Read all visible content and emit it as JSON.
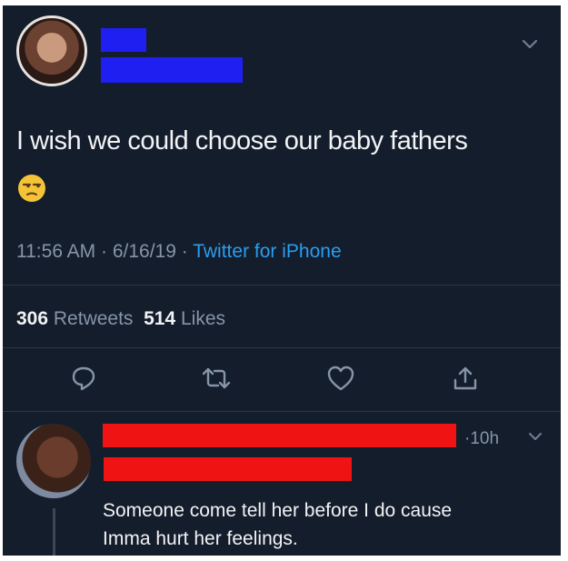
{
  "tweet": {
    "text": "I wish we could choose our baby fathers",
    "emoji": "😒",
    "time": "11:56 AM",
    "date": "6/16/19",
    "sep": " · ",
    "source": "Twitter for iPhone",
    "retweets_count": "306",
    "retweets_label": "Retweets",
    "likes_count": "514",
    "likes_label": "Likes"
  },
  "reply": {
    "time": "·10h",
    "text_line1": "Someone come tell her before I do cause",
    "text_line2": "Imma hurt her feelings."
  },
  "colors": {
    "background": "#141d2b",
    "link": "#2a9df1",
    "redact_blue": "#1f1ff2",
    "redact_red": "#f01313"
  },
  "icons": [
    "chevron-down-icon",
    "reply-icon",
    "retweet-icon",
    "like-icon",
    "share-icon"
  ]
}
